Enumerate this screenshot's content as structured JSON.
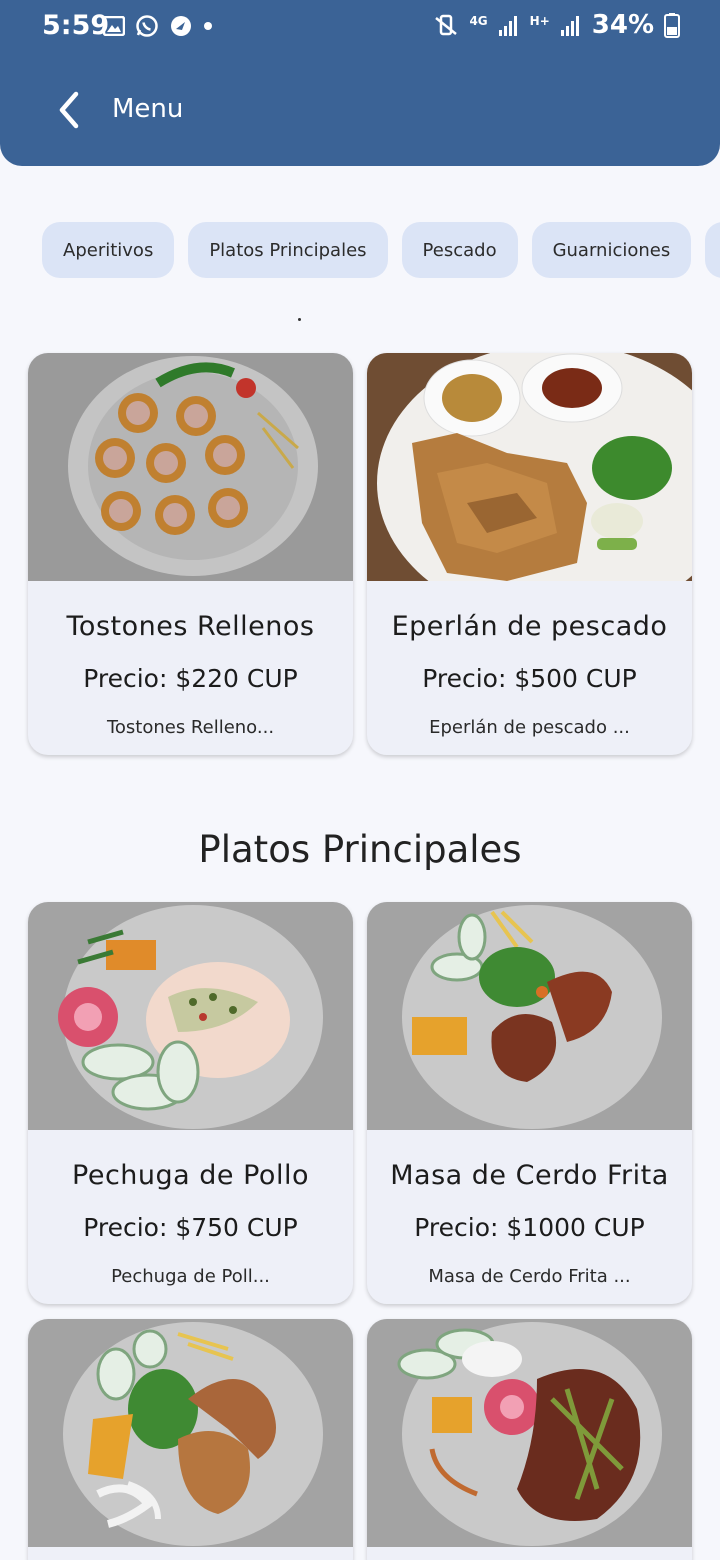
{
  "status_bar": {
    "time": "5:59",
    "network": "4G",
    "network2": "H+",
    "battery": "34%"
  },
  "app_bar": {
    "title": "Menu"
  },
  "tabs": [
    "Aperitivos",
    "Platos Principales",
    "Pescado",
    "Guarniciones"
  ],
  "section_title": "Platos Principales",
  "cards": [
    {
      "name": "Tostones Rellenos",
      "price": "Precio: $220 CUP",
      "desc": "Tostones Relleno..."
    },
    {
      "name": "Eperlán de pescado",
      "price": "Precio: $500 CUP",
      "desc": "Eperlán de pescado    ..."
    },
    {
      "name": "Pechuga de Pollo",
      "price": "Precio: $750 CUP",
      "desc": "Pechuga de Poll..."
    },
    {
      "name": "Masa de Cerdo Frita",
      "price": "Precio: $1000 CUP",
      "desc": "Masa de Cerdo Frita    ..."
    },
    {
      "name": "",
      "price": "",
      "desc": ""
    },
    {
      "name": "",
      "price": "",
      "desc": ""
    }
  ],
  "colors": {
    "header": "#3b6396",
    "tab": "#dbe4f6",
    "background": "#f6f7fc",
    "card": "#eef0f8"
  }
}
